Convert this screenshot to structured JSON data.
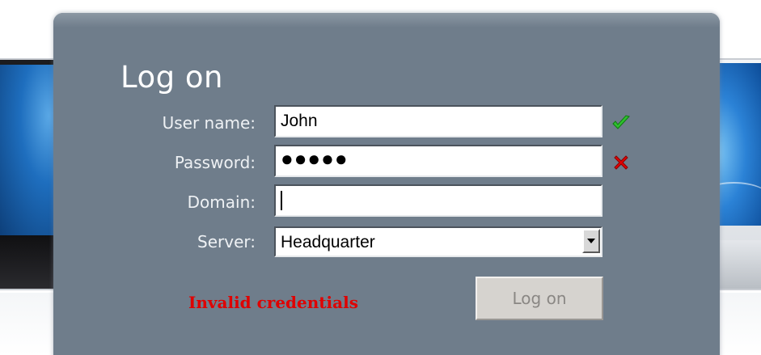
{
  "dialog": {
    "title": "Log on",
    "fields": {
      "username": {
        "label": "User name:",
        "value": "John",
        "status": "valid"
      },
      "password": {
        "label": "Password:",
        "value": "●●●●●",
        "status": "invalid"
      },
      "domain": {
        "label": "Domain:",
        "value": ""
      },
      "server": {
        "label": "Server:",
        "value": "Headquarter"
      }
    },
    "error_message": "Invalid credentials",
    "logon_button_label": "Log on"
  },
  "icons": {
    "valid": "checkmark-icon",
    "invalid": "red-x-icon",
    "dropdown": "dropdown-arrow-icon"
  },
  "colors": {
    "dialog_bg": "#6f7d8b",
    "error": "#e00000",
    "valid": "#22bb22",
    "invalid": "#dd0000"
  }
}
